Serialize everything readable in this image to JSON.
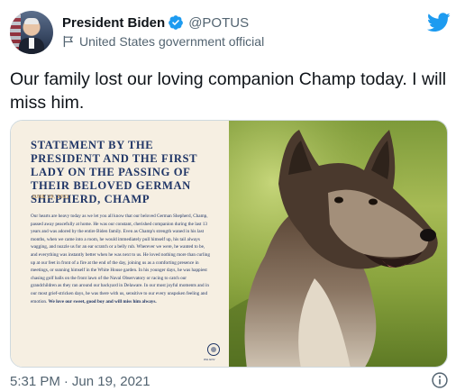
{
  "author": {
    "name": "President Biden",
    "handle": "@POTUS",
    "label": "United States government official",
    "avatar": "avatar-photo"
  },
  "tweet": {
    "text": "Our family lost our loving companion Champ today. I will miss him."
  },
  "statement": {
    "title": "Statement by the President and the First Lady on the Passing of their Beloved German Shepherd, Champ",
    "date": "JUNE 19, 2021",
    "body": "Our hearts are heavy today as we let you all know that our beloved German Shepherd, Champ, passed away peacefully at home. He was our constant, cherished companion during the last 13 years and was adored by the entire Biden family. Even as Champ's strength waned in his last months, when we came into a room, he would immediately pull himself up, his tail always wagging, and nuzzle us for an ear scratch or a belly rub. Wherever we were, he wanted to be, and everything was instantly better when he was next to us. He loved nothing more than curling up at our feet in front of a fire at the end of the day, joining us as a comforting presence in meetings, or sunning himself in the White House garden. In his younger days, he was happiest chasing golf balls on the front lawn of the Naval Observatory or racing to catch our grandchildren as they ran around our backyard in Delaware. In our most joyful moments and in our most grief-stricken days, he was there with us, sensitive to our every unspoken feeling and emotion.",
    "closing": "We love our sweet, good boy and will miss him always.",
    "seal_caption": "WH.GOV"
  },
  "footer": {
    "time": "5:31 PM",
    "separator": "·",
    "date": "Jun 19, 2021"
  },
  "icons": {
    "verified": "verified-badge-icon",
    "flag": "government-flag-icon",
    "bird": "twitter-bird-icon",
    "info": "info-icon"
  },
  "colors": {
    "twitter_blue": "#1d9bf0",
    "text_primary": "#0f1419",
    "text_secondary": "#536471",
    "statement_navy": "#1f3566",
    "statement_gold": "#c9a062",
    "statement_bg": "#f6efe2"
  }
}
